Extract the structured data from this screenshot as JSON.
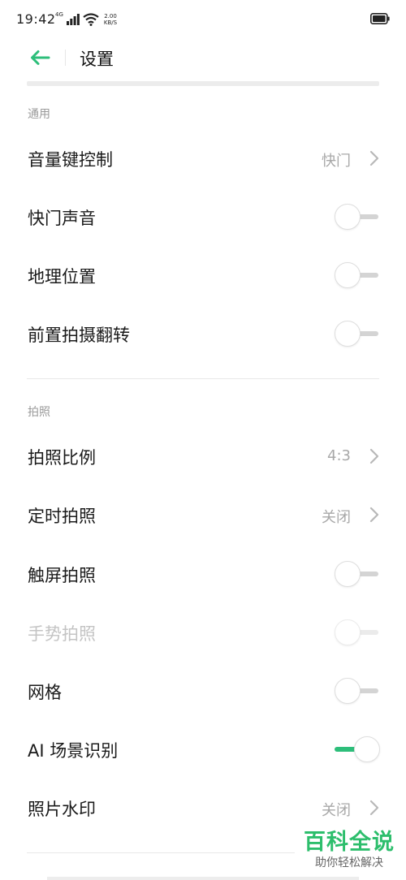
{
  "status_bar": {
    "time": "19:42",
    "network": "4G",
    "speed_value": "2.00",
    "speed_unit": "KB/S"
  },
  "header": {
    "title": "设置"
  },
  "sections": {
    "general": {
      "title": "通用",
      "volume_key": {
        "label": "音量键控制",
        "value": "快门"
      },
      "shutter_sound": {
        "label": "快门声音",
        "state": "off"
      },
      "location": {
        "label": "地理位置",
        "state": "off"
      },
      "front_flip": {
        "label": "前置拍摄翻转",
        "state": "off"
      }
    },
    "photo": {
      "title": "拍照",
      "aspect_ratio": {
        "label": "拍照比例",
        "value": "4:3"
      },
      "timer": {
        "label": "定时拍照",
        "value": "关闭"
      },
      "touch_shoot": {
        "label": "触屏拍照",
        "state": "off"
      },
      "gesture_shoot": {
        "label": "手势拍照",
        "state": "disabled"
      },
      "grid": {
        "label": "网格",
        "state": "off"
      },
      "ai_scene": {
        "label": "AI 场景识别",
        "state": "on"
      },
      "watermark": {
        "label": "照片水印",
        "value": "关闭"
      }
    }
  },
  "watermark_logo": {
    "main": "百科全说",
    "sub": "助你轻松解决"
  },
  "colors": {
    "accent": "#2dbe7a",
    "watermark_green": "#2dbe6c",
    "secondary_text": "#a8a8a8"
  }
}
